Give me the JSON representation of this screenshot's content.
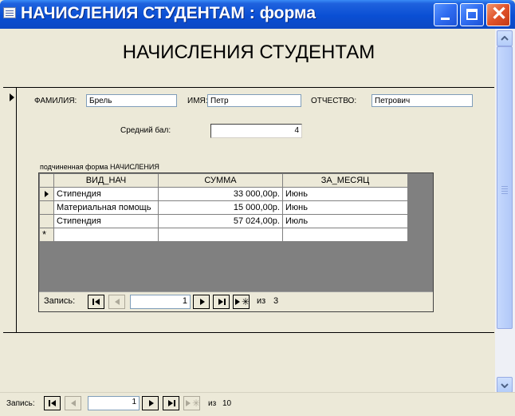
{
  "window": {
    "title": "НАЧИСЛЕНИЯ СТУДЕНТАМ : форма",
    "icon": "form-icon"
  },
  "form": {
    "heading": "НАЧИСЛЕНИЯ СТУДЕНТАМ",
    "fields": {
      "lastname_label": "ФАМИЛИЯ:",
      "lastname_value": "Брель",
      "firstname_label": "ИМЯ:",
      "firstname_value": "Петр",
      "patronymic_label": "ОТЧЕСТВО:",
      "patronymic_value": "Петрович",
      "avg_label": "Средний бал:",
      "avg_value": "4"
    }
  },
  "subform": {
    "label": "подчиненная форма НАЧИСЛЕНИЯ",
    "columns": [
      "ВИД_НАЧ",
      "СУММА",
      "ЗА_МЕСЯЦ"
    ],
    "rows": [
      {
        "type": "Стипендия",
        "sum": "33 000,00р.",
        "month": "Июнь"
      },
      {
        "type": "Материальная помощь",
        "sum": "15 000,00р.",
        "month": "Июнь"
      },
      {
        "type": "Стипендия",
        "sum": "57 024,00р.",
        "month": "Июль"
      }
    ],
    "new_row_marker": "*",
    "nav": {
      "label": "Запись:",
      "current": "1",
      "of_label": "из",
      "total": "3"
    }
  },
  "main_nav": {
    "label": "Запись:",
    "current": "1",
    "of_label": "из",
    "total": "10"
  }
}
